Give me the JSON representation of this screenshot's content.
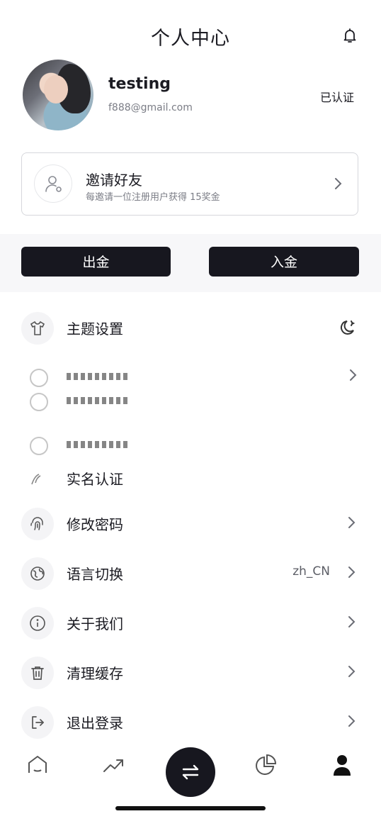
{
  "header": {
    "title": "个人中心",
    "bell_icon": "bell-icon"
  },
  "profile": {
    "username": "testing",
    "email": "f888@gmail.com",
    "status": "已认证"
  },
  "invite": {
    "title": "邀请好友",
    "subtitle": "每邀请一位注册用户获得 15奖金",
    "icon": "user-plus-icon"
  },
  "actions": {
    "withdraw": "出金",
    "deposit": "入金"
  },
  "menu": {
    "theme_label": "主题设置",
    "item_kyc": "实名认证",
    "item_password": "修改密码",
    "item_language": "语言切换",
    "language_value": "zh_CN",
    "item_about": "关于我们",
    "item_cache": "清理缓存",
    "item_logout": "退出登录"
  },
  "tabbar": {
    "items": [
      "home-icon",
      "trend-icon",
      "exchange-icon",
      "pie-chart-icon",
      "user-icon"
    ]
  },
  "colors": {
    "primary": "#17171f",
    "muted": "#7b7d86",
    "background": "#ffffff"
  }
}
